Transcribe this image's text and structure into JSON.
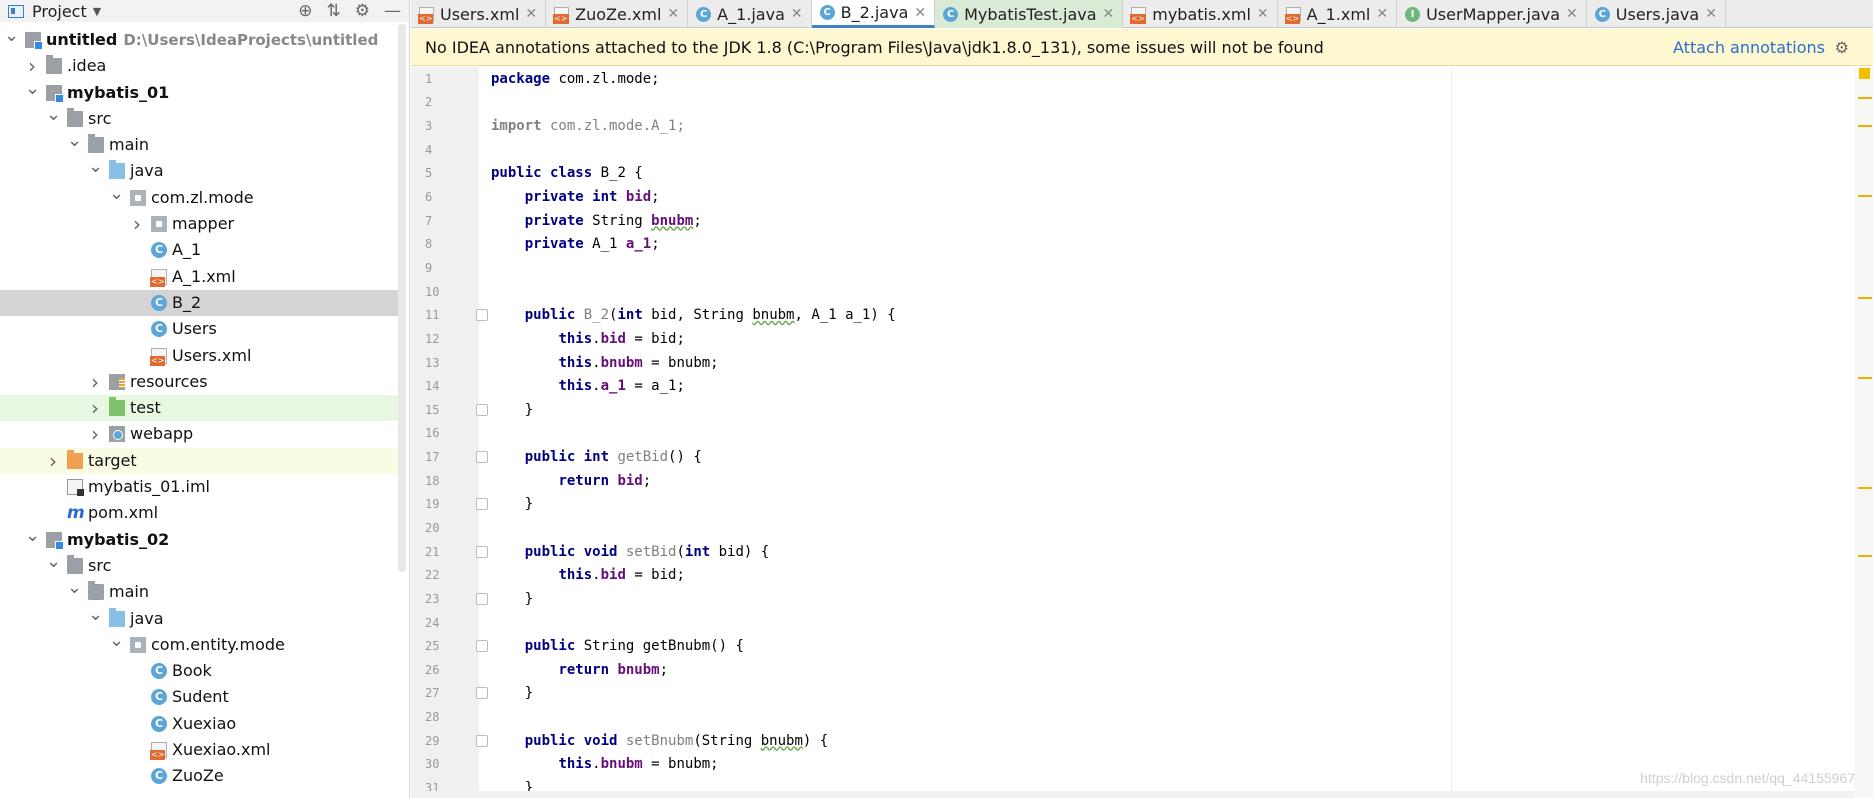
{
  "project_panel": {
    "title": "Project",
    "tree": [
      {
        "label": "untitled",
        "extra": "D:\\Users\\IdeaProjects\\untitled",
        "depth": 0,
        "arrow": "open",
        "icon": "module-folder",
        "bold": true
      },
      {
        "label": ".idea",
        "depth": 1,
        "arrow": "closed",
        "icon": "folder"
      },
      {
        "label": "mybatis_01",
        "depth": 1,
        "arrow": "open",
        "icon": "module-folder",
        "bold": true
      },
      {
        "label": "src",
        "depth": 2,
        "arrow": "open",
        "icon": "folder"
      },
      {
        "label": "main",
        "depth": 3,
        "arrow": "open",
        "icon": "folder"
      },
      {
        "label": "java",
        "depth": 4,
        "arrow": "open",
        "icon": "source-folder"
      },
      {
        "label": "com.zl.mode",
        "depth": 5,
        "arrow": "open",
        "icon": "package"
      },
      {
        "label": "mapper",
        "depth": 6,
        "arrow": "closed",
        "icon": "package"
      },
      {
        "label": "A_1",
        "depth": 6,
        "icon": "class"
      },
      {
        "label": "A_1.xml",
        "depth": 6,
        "icon": "xml-file"
      },
      {
        "label": "B_2",
        "depth": 6,
        "icon": "class",
        "state": "selected"
      },
      {
        "label": "Users",
        "depth": 6,
        "icon": "class"
      },
      {
        "label": "Users.xml",
        "depth": 6,
        "icon": "xml-file"
      },
      {
        "label": "resources",
        "depth": 4,
        "arrow": "closed",
        "icon": "resources-folder"
      },
      {
        "label": "test",
        "depth": 4,
        "arrow": "closed",
        "icon": "test-folder",
        "state": "test"
      },
      {
        "label": "webapp",
        "depth": 4,
        "arrow": "closed",
        "icon": "web-folder"
      },
      {
        "label": "target",
        "depth": 2,
        "arrow": "closed",
        "icon": "excluded-folder",
        "state": "target"
      },
      {
        "label": "mybatis_01.iml",
        "depth": 2,
        "icon": "iml-file"
      },
      {
        "label": "pom.xml",
        "depth": 2,
        "icon": "maven-file"
      },
      {
        "label": "mybatis_02",
        "depth": 1,
        "arrow": "open",
        "icon": "module-folder",
        "bold": true
      },
      {
        "label": "src",
        "depth": 2,
        "arrow": "open",
        "icon": "folder"
      },
      {
        "label": "main",
        "depth": 3,
        "arrow": "open",
        "icon": "folder"
      },
      {
        "label": "java",
        "depth": 4,
        "arrow": "open",
        "icon": "source-folder"
      },
      {
        "label": "com.entity.mode",
        "depth": 5,
        "arrow": "open",
        "icon": "package"
      },
      {
        "label": "Book",
        "depth": 6,
        "icon": "class"
      },
      {
        "label": "Sudent",
        "depth": 6,
        "icon": "class"
      },
      {
        "label": "Xuexiao",
        "depth": 6,
        "icon": "class"
      },
      {
        "label": "Xuexiao.xml",
        "depth": 6,
        "icon": "xml-file"
      },
      {
        "label": "ZuoZe",
        "depth": 6,
        "icon": "class"
      }
    ]
  },
  "tabs": [
    {
      "label": "Users.xml",
      "icon": "xml-file"
    },
    {
      "label": "ZuoZe.xml",
      "icon": "xml-file"
    },
    {
      "label": "A_1.java",
      "icon": "class"
    },
    {
      "label": "B_2.java",
      "icon": "class",
      "active": true
    },
    {
      "label": "MybatisTest.java",
      "icon": "class",
      "green": true
    },
    {
      "label": "mybatis.xml",
      "icon": "xml-file"
    },
    {
      "label": "A_1.xml",
      "icon": "xml-file"
    },
    {
      "label": "UserMapper.java",
      "icon": "interface"
    },
    {
      "label": "Users.java",
      "icon": "class"
    }
  ],
  "banner": {
    "message": "No IDEA annotations attached to the JDK 1.8 (C:\\Program Files\\Java\\jdk1.8.0_131), some issues will not be found",
    "action": "Attach annotations"
  },
  "code_lines": [
    {
      "n": "1",
      "html": "<span class='kw'>package</span> com.zl.mode;"
    },
    {
      "n": "2",
      "html": ""
    },
    {
      "n": "3",
      "html": "<span class='gray'><b>import</b> com.zl.mode.A_1;</span>"
    },
    {
      "n": "4",
      "html": ""
    },
    {
      "n": "5",
      "html": "<span class='kw'>public class</span> B_2 {"
    },
    {
      "n": "6",
      "html": "    <span class='kw'>private int</span> <span class='fld'>bid</span>;"
    },
    {
      "n": "7",
      "html": "    <span class='kw'>private</span> String <span class='fld typo'>bnubm</span>;"
    },
    {
      "n": "8",
      "html": "    <span class='kw'>private</span> A_1 <span class='fld'>a_1</span>;"
    },
    {
      "n": "9",
      "html": ""
    },
    {
      "n": "10",
      "html": ""
    },
    {
      "n": "11",
      "html": "    <span class='kw'>public</span> <span class='gray'>B_2</span>(<span class='kw'>int</span> bid, String <span class='typo'>bnubm</span>, A_1 a_1) {",
      "fold": true
    },
    {
      "n": "12",
      "html": "        <span class='kw'>this</span>.<span class='fld'>bid</span> = bid;"
    },
    {
      "n": "13",
      "html": "        <span class='kw'>this</span>.<span class='fld'>bnubm</span> = bnubm;"
    },
    {
      "n": "14",
      "html": "        <span class='kw'>this</span>.<span class='fld'>a_1</span> = a_1;"
    },
    {
      "n": "15",
      "html": "    }",
      "fold": true
    },
    {
      "n": "16",
      "html": ""
    },
    {
      "n": "17",
      "html": "    <span class='kw'>public int</span> <span class='gray'>getBid</span>() {",
      "fold": true
    },
    {
      "n": "18",
      "html": "        <span class='kw'>return</span> <span class='fld'>bid</span>;"
    },
    {
      "n": "19",
      "html": "    }",
      "fold": true
    },
    {
      "n": "20",
      "html": ""
    },
    {
      "n": "21",
      "html": "    <span class='kw'>public void</span> <span class='gray'>setBid</span>(<span class='kw'>int</span> bid) {",
      "fold": true
    },
    {
      "n": "22",
      "html": "        <span class='kw'>this</span>.<span class='fld'>bid</span> = bid;"
    },
    {
      "n": "23",
      "html": "    }",
      "fold": true
    },
    {
      "n": "24",
      "html": ""
    },
    {
      "n": "25",
      "html": "    <span class='kw'>public</span> String getBnubm() {",
      "fold": true
    },
    {
      "n": "26",
      "html": "        <span class='kw'>return</span> <span class='fld'>bnubm</span>;"
    },
    {
      "n": "27",
      "html": "    }",
      "fold": true
    },
    {
      "n": "28",
      "html": ""
    },
    {
      "n": "29",
      "html": "    <span class='kw'>public void</span> <span class='gray'>setBnubm</span>(String <span class='typo'>bnubm</span>) {",
      "fold": true
    },
    {
      "n": "30",
      "html": "        <span class='kw'>this</span>.<span class='fld'>bnubm</span> = bnubm;"
    },
    {
      "n": "31",
      "html": "    }"
    }
  ],
  "watermark": "https://blog.csdn.net/qq_44155967"
}
